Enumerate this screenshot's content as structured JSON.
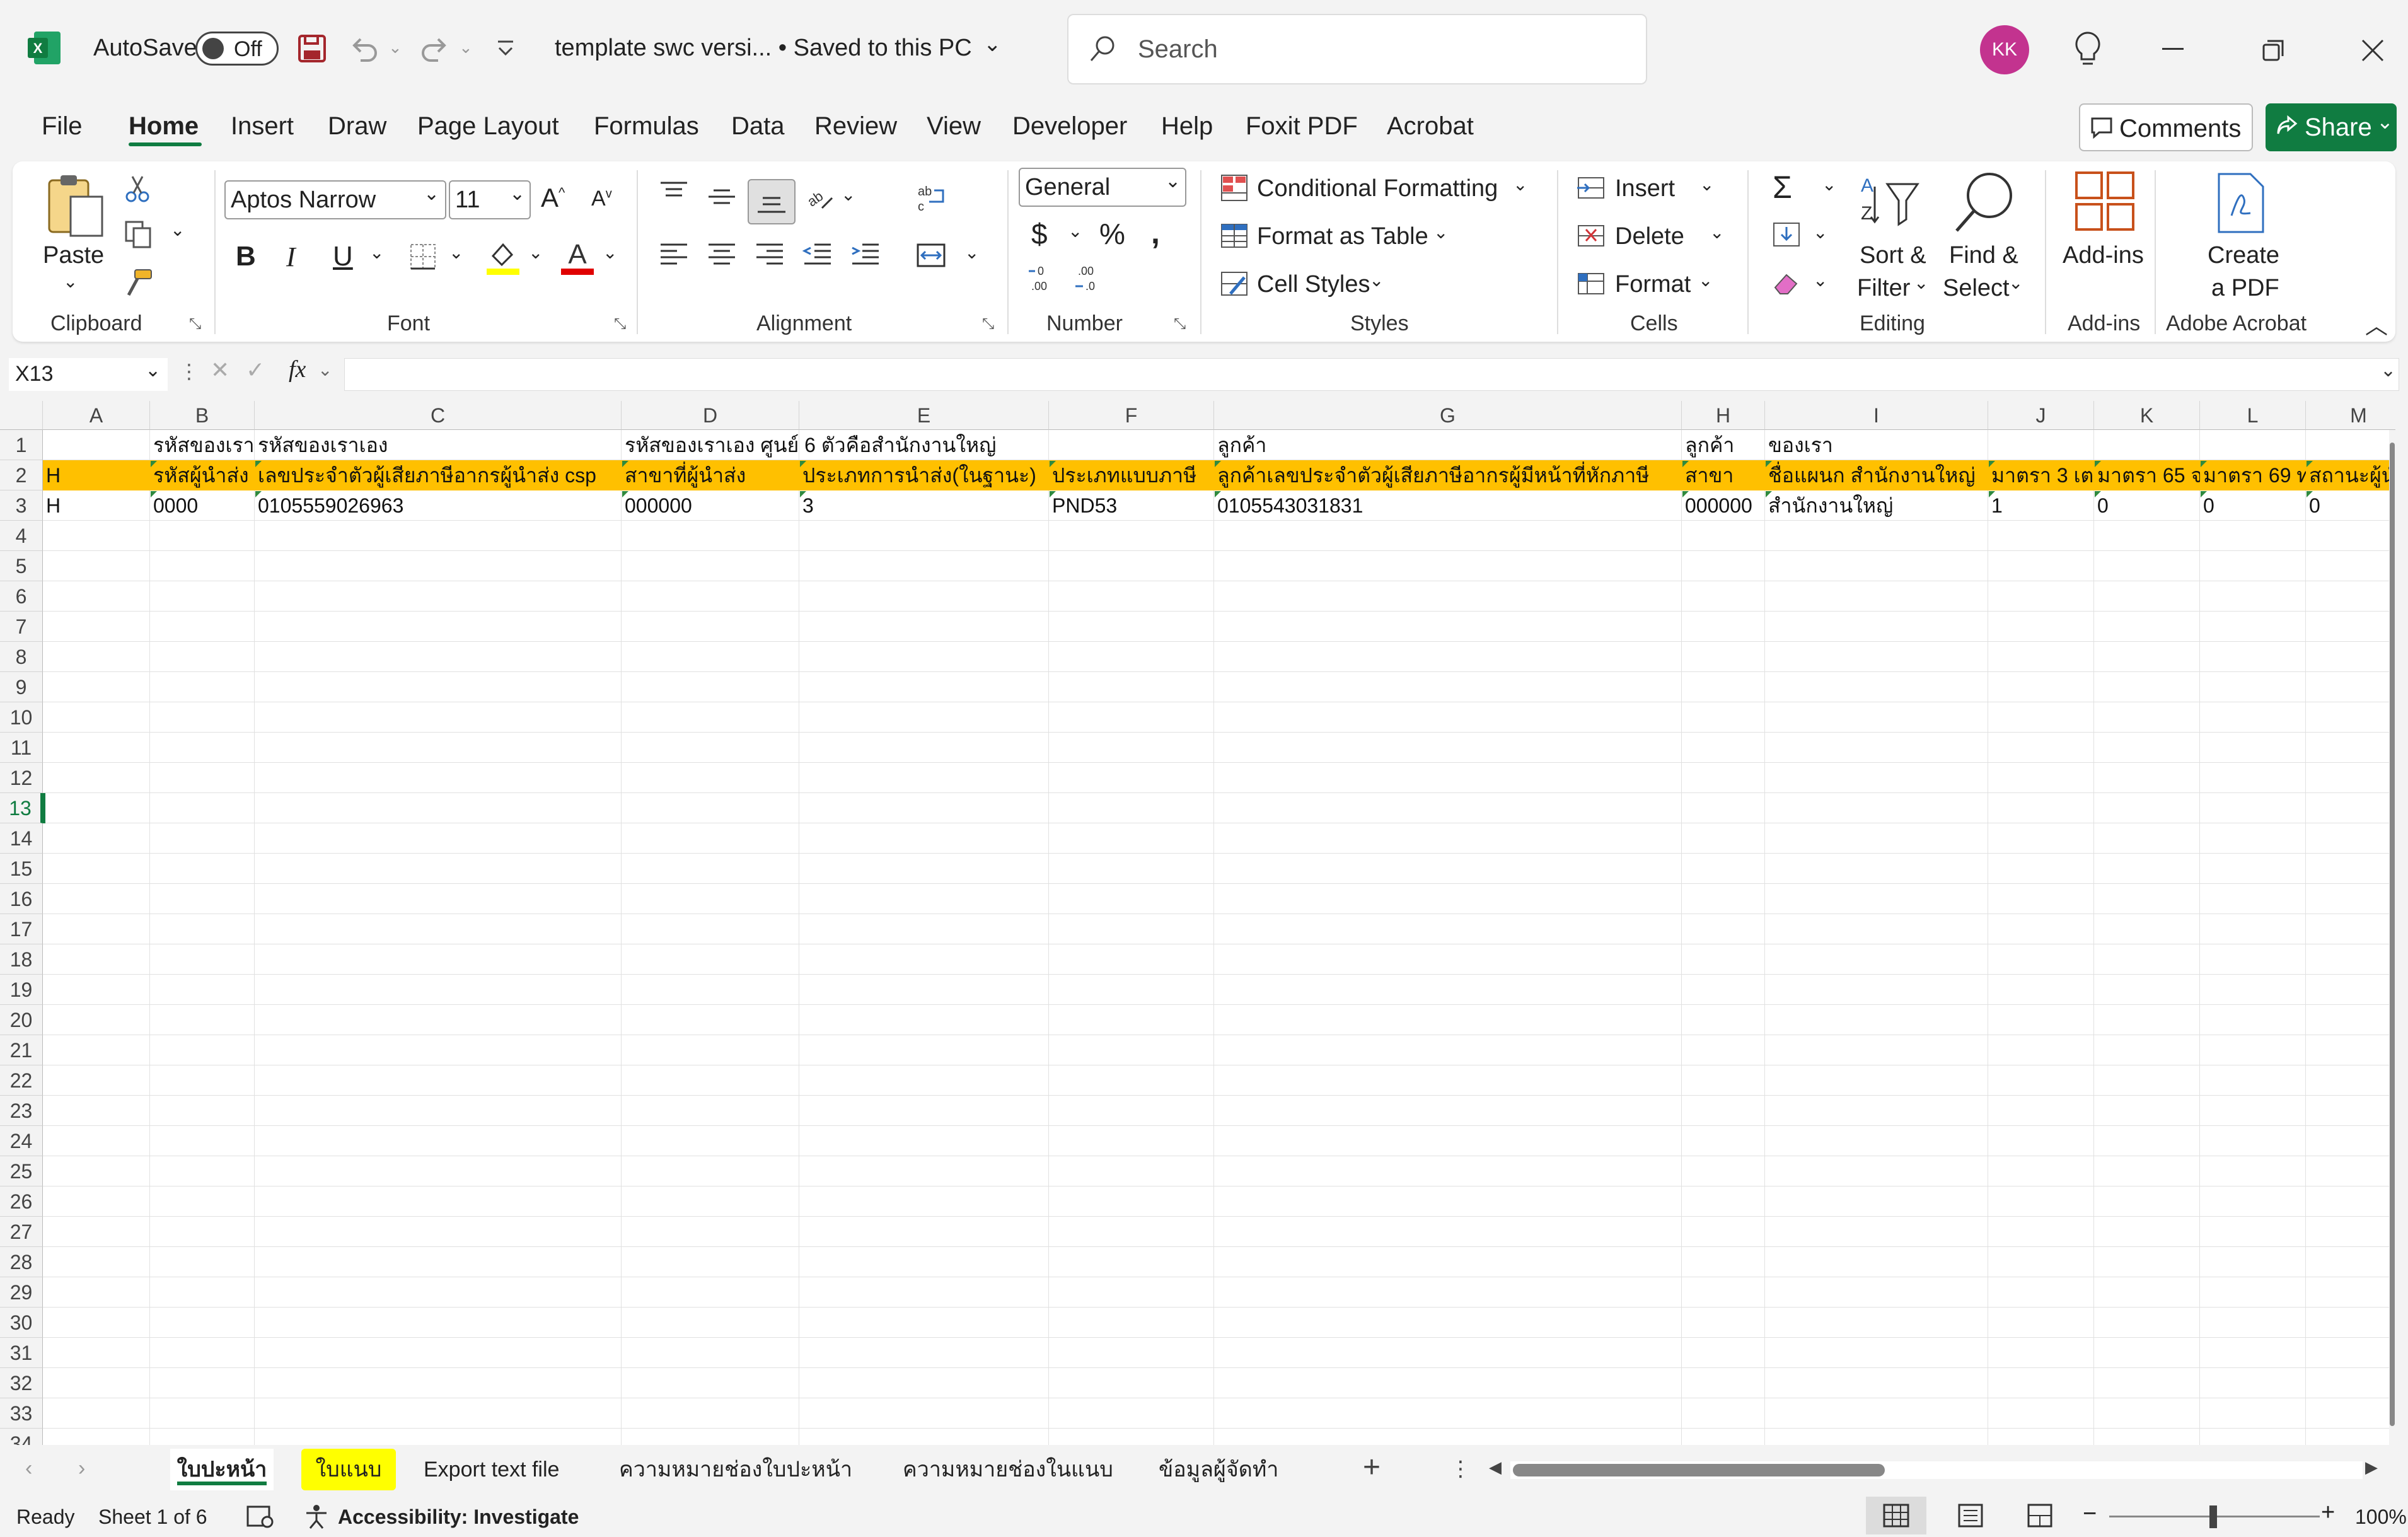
{
  "titlebar": {
    "autosave_label": "AutoSave",
    "autosave_state": "Off",
    "doc_title": "template swc versi...  • Saved to this PC",
    "search_placeholder": "Search",
    "user_initials": "KK"
  },
  "menu": [
    "File",
    "Home",
    "Insert",
    "Draw",
    "Page Layout",
    "Formulas",
    "Data",
    "Review",
    "View",
    "Developer",
    "Help",
    "Foxit PDF",
    "Acrobat"
  ],
  "menu_active": "Home",
  "buttons": {
    "comments": "Comments",
    "share": "Share"
  },
  "ribbon": {
    "clipboard": {
      "paste": "Paste",
      "group": "Clipboard"
    },
    "font": {
      "name": "Aptos Narrow",
      "size": "11",
      "group": "Font"
    },
    "alignment": {
      "group": "Alignment"
    },
    "number": {
      "format": "General",
      "group": "Number"
    },
    "styles": {
      "conditional": "Conditional Formatting",
      "format_table": "Format as Table",
      "cell_styles": "Cell Styles",
      "group": "Styles"
    },
    "cells": {
      "insert": "Insert",
      "delete": "Delete",
      "format": "Format",
      "group": "Cells"
    },
    "editing": {
      "sort1": "Sort &",
      "sort2": "Filter",
      "find1": "Find &",
      "find2": "Select",
      "group": "Editing"
    },
    "addins": {
      "label": "Add-ins",
      "group": "Add-ins"
    },
    "acrobat": {
      "label1": "Create",
      "label2": "a PDF",
      "group": "Adobe Acrobat"
    }
  },
  "formula_bar": {
    "name_box": "X13",
    "formula": ""
  },
  "columns": [
    "A",
    "B",
    "C",
    "D",
    "E",
    "F",
    "G",
    "H",
    "I",
    "J",
    "K",
    "L",
    "M"
  ],
  "rows": [
    "1",
    "2",
    "3",
    "4",
    "5",
    "6",
    "7",
    "8",
    "9",
    "10",
    "11",
    "12",
    "13",
    "14",
    "15",
    "16",
    "17",
    "18",
    "19",
    "20",
    "21",
    "22",
    "23",
    "24",
    "25",
    "26",
    "27",
    "28",
    "29",
    "30",
    "31",
    "32",
    "33",
    "34"
  ],
  "cells": {
    "r1": [
      "",
      "รหัสของเรา",
      "รหัสของเราเอง",
      "รหัสของเราเอง ศูนย์ 6 ตัวคือสำนักงานใหญ่",
      "",
      "",
      "ลูกค้า",
      "ลูกค้า",
      "ของเรา",
      "",
      "",
      "",
      ""
    ],
    "r2": [
      "H",
      "รหัสผู้นำส่ง",
      "เลขประจำตัวผู้เสียภาษีอากรผู้นำส่ง csp",
      "สาขาที่ผู้นำส่ง",
      "ประเภทการนำส่ง(ในฐานะ)",
      "ประเภทแบบภาษี",
      "ลูกค้าเลขประจำตัวผู้เสียภาษีอากรผู้มีหน้าที่หักภาษี",
      "สาขา",
      "ชื่อแผนก สำนักงานใหญ่",
      "มาตรา 3 เต",
      "มาตรา 65 จ",
      "มาตรา 69 ท",
      "สถานะผู้นำ"
    ],
    "r3": [
      "H",
      "0000",
      "0105559026963",
      "000000",
      "3",
      "PND53",
      "0105543031831",
      "000000",
      "สำนักงานใหญ่",
      "1",
      "0",
      "0",
      "0"
    ]
  },
  "sheets": [
    "ใบปะหน้า",
    "ใบแนบ",
    "Export text file",
    "ความหมายช่องใบปะหน้า",
    "ความหมายช่องในแนบ",
    "ข้อมูลผู้จัดทำ"
  ],
  "active_sheet": "ใบปะหน้า",
  "status": {
    "ready": "Ready",
    "sheet": "Sheet 1 of 6",
    "accessibility": "Accessibility: Investigate",
    "zoom": "100%"
  },
  "colors": {
    "excel_green": "#107c41",
    "header_fill": "#ffc000",
    "tab_highlight": "#ffff00",
    "avatar": "#c3338f"
  }
}
